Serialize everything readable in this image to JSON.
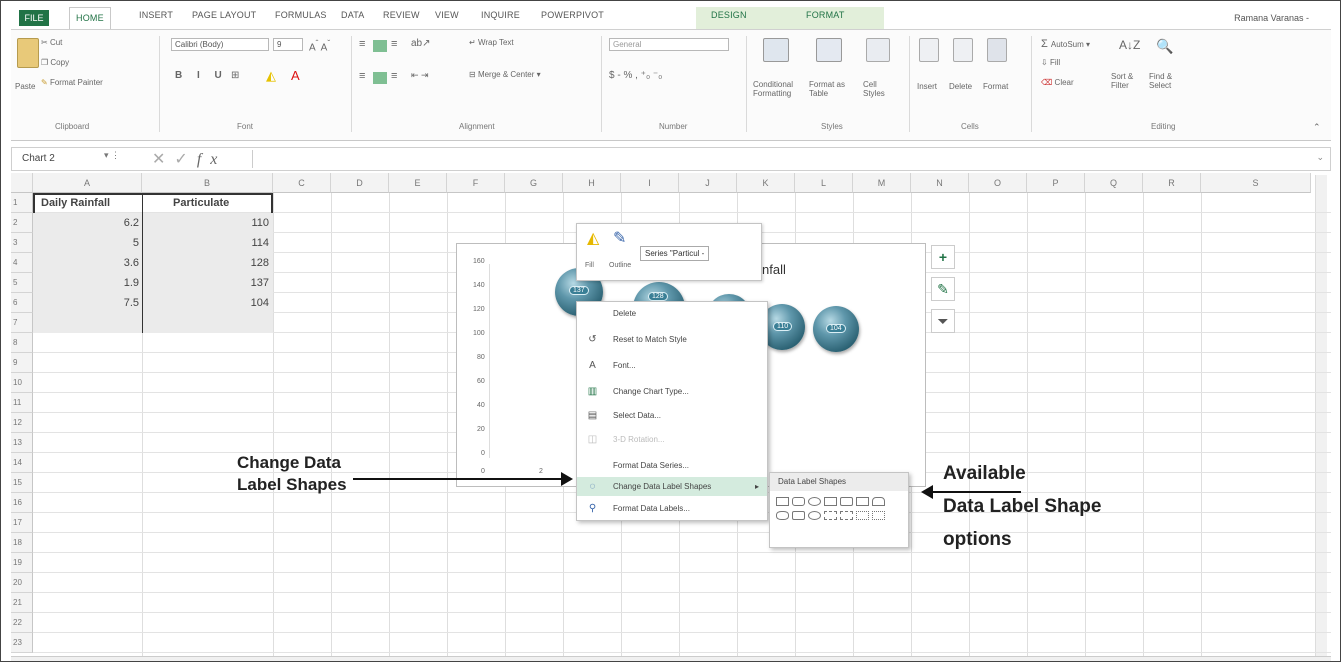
{
  "tabs": {
    "file": "FILE",
    "items": [
      "HOME",
      "INSERT",
      "PAGE LAYOUT",
      "FORMULAS",
      "DATA",
      "REVIEW",
      "VIEW",
      "INQUIRE",
      "POWERPIVOT",
      "DESIGN",
      "FORMAT"
    ],
    "user": "Ramana Varanas -"
  },
  "ribbon": {
    "clipboard": {
      "cut": "Cut",
      "copy": "Copy",
      "paste": "Paste",
      "format_painter": "Format Painter",
      "label": "Clipboard"
    },
    "font": {
      "name": "Calibri (Body)",
      "size": "9",
      "label": "Font"
    },
    "alignment": {
      "wrap": "Wrap Text",
      "merge": "Merge & Center",
      "label": "Alignment"
    },
    "number": {
      "format": "General",
      "label": "Number"
    },
    "styles": {
      "cond": "Conditional Formatting",
      "fmt_table": "Format as Table",
      "cell_styles": "Cell Styles",
      "label": "Styles"
    },
    "cells": {
      "insert": "Insert",
      "delete": "Delete",
      "format": "Format",
      "label": "Cells"
    },
    "editing": {
      "autosum": "AutoSum",
      "fill": "Fill",
      "clear": "Clear",
      "sort": "Sort & Filter",
      "find": "Find & Select",
      "label": "Editing"
    }
  },
  "formula_bar": {
    "name_box": "Chart 2",
    "fx": "fx"
  },
  "columns": [
    "A",
    "B",
    "C",
    "D",
    "E",
    "F",
    "G",
    "H",
    "I",
    "J",
    "K",
    "L",
    "M",
    "N",
    "O",
    "P",
    "Q",
    "R",
    "S"
  ],
  "rows": [
    "1",
    "2",
    "3",
    "4",
    "5",
    "6",
    "7",
    "8",
    "9",
    "10",
    "11",
    "12",
    "13",
    "14",
    "15",
    "16",
    "17",
    "18",
    "19",
    "20",
    "21",
    "22",
    "23"
  ],
  "table": {
    "headers": [
      "Daily Rainfall",
      "Particulate"
    ],
    "rows": [
      [
        "6.2",
        "110"
      ],
      [
        "5",
        "114"
      ],
      [
        "3.6",
        "128"
      ],
      [
        "1.9",
        "137"
      ],
      [
        "7.5",
        "104"
      ]
    ]
  },
  "chart": {
    "title_fragment": "nfall",
    "y_ticks": [
      "160",
      "140",
      "120",
      "100",
      "80",
      "60",
      "40",
      "20",
      "0"
    ],
    "x_ticks": [
      "0",
      "2"
    ],
    "bubble_labels": [
      "110",
      "114",
      "128",
      "137",
      "104"
    ]
  },
  "mini_toolbar": {
    "fill": "Fill",
    "outline": "Outline",
    "series": "Series \"Particul -"
  },
  "context_menu": {
    "items": [
      "Delete",
      "Reset to Match Style",
      "Font...",
      "Change Chart Type...",
      "Select Data...",
      "3-D Rotation...",
      "Format Data Series...",
      "Change Data Label Shapes",
      "Format Data Labels..."
    ]
  },
  "submenu": {
    "title": "Data Label Shapes"
  },
  "annotations": {
    "left_line1": "Change Data",
    "left_line2": "Label Shapes",
    "right_line1": "Available",
    "right_line2": "Data Label Shape",
    "right_line3": "options"
  },
  "colors": {
    "accent": "#217346",
    "highlight": "#d4ebde",
    "bubble": "#3a7f96"
  }
}
